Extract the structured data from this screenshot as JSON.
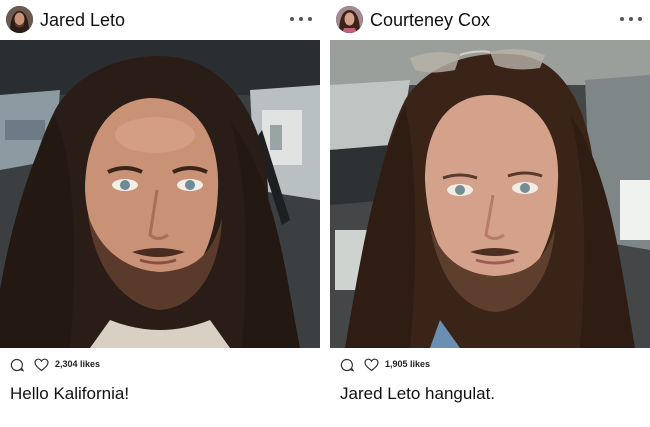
{
  "posts": [
    {
      "username": "Jared Leto",
      "likes": "2,304 likes",
      "caption": "Hello Kalifornia!",
      "icons": {
        "more": "more-options-icon",
        "comment": "comment-icon",
        "like": "heart-icon"
      }
    },
    {
      "username": "Courteney Cox",
      "likes": "1,905 likes",
      "caption": "Jared Leto hangulat.",
      "icons": {
        "more": "more-options-icon",
        "comment": "comment-icon",
        "like": "heart-icon"
      }
    }
  ],
  "colors": {
    "text": "#111111",
    "icon": "#555555",
    "skin": "#c99176",
    "hair": "#2a1d17",
    "car_interior": "#3b3f42"
  }
}
